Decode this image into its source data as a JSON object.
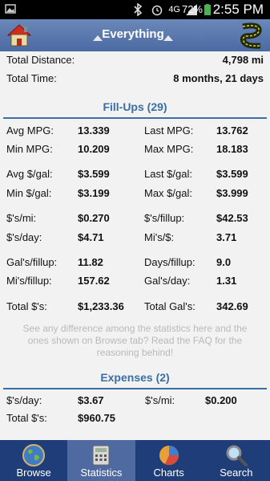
{
  "status": {
    "network": "4G",
    "battery": "72%",
    "time": "2:55 PM"
  },
  "header": {
    "title": "Everything"
  },
  "summary": {
    "distance_label": "Total Distance:",
    "distance_value": "4,798 mi",
    "time_label": "Total Time:",
    "time_value": "8 months, 21 days"
  },
  "fillups": {
    "title": "Fill-Ups (29)",
    "rows": [
      {
        "l1": "Avg MPG:",
        "v1": "13.339",
        "l2": "Last MPG:",
        "v2": "13.762"
      },
      {
        "l1": "Min MPG:",
        "v1": "10.209",
        "l2": "Max MPG:",
        "v2": "18.183"
      },
      {
        "l1": "Avg $/gal:",
        "v1": "$3.599",
        "l2": "Last $/gal:",
        "v2": "$3.599"
      },
      {
        "l1": "Min $/gal:",
        "v1": "$3.199",
        "l2": "Max $/gal:",
        "v2": "$3.999"
      },
      {
        "l1": "$'s/mi:",
        "v1": "$0.270",
        "l2": "$'s/fillup:",
        "v2": "$42.53"
      },
      {
        "l1": "$'s/day:",
        "v1": "$4.71",
        "l2": "Mi's/$:",
        "v2": "3.71"
      },
      {
        "l1": "Gal's/fillup:",
        "v1": "11.82",
        "l2": "Days/fillup:",
        "v2": "9.0"
      },
      {
        "l1": "Mi's/fillup:",
        "v1": "157.62",
        "l2": "Gal's/day:",
        "v2": "1.31"
      },
      {
        "l1": "Total $'s:",
        "v1": "$1,233.36",
        "l2": "Total Gal's:",
        "v2": "342.69"
      }
    ]
  },
  "note": "See any difference among the statistics here and the ones shown on Browse tab? Read the FAQ for the reasoning behind!",
  "expenses": {
    "title": "Expenses (2)",
    "rows": [
      {
        "l1": "$'s/day:",
        "v1": "$3.67",
        "l2": "$'s/mi:",
        "v2": "$0.200"
      },
      {
        "l1": "Total $'s:",
        "v1": "$960.75"
      }
    ]
  },
  "tabs": [
    {
      "label": "Browse",
      "icon": "globe-icon"
    },
    {
      "label": "Statistics",
      "icon": "calculator-icon",
      "active": true
    },
    {
      "label": "Charts",
      "icon": "pie-chart-icon"
    },
    {
      "label": "Search",
      "icon": "magnifier-icon"
    }
  ],
  "colors": {
    "header": "#5878ad",
    "accent": "#3a6ea5",
    "tabbar": "#1f3d78",
    "tab_active": "#4f6aa1"
  }
}
